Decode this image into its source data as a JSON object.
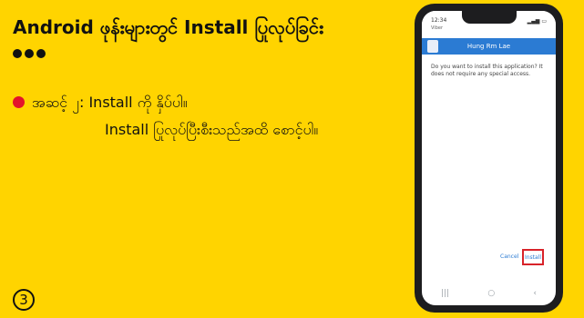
{
  "slide": {
    "title": "Android ဖုန်းများတွင် Install ပြုလုပ်ခြင်း",
    "step_line1": "အဆင့် ၂: Install ကို နှိပ်ပါ။",
    "step_line2": "Install ပြုလုပ်ပြီးစီးသည်အထိ စောင့်ပါ။",
    "step_number": "3",
    "accent_color": "#ffd400",
    "bullet_color": "#e3132b"
  },
  "phone": {
    "status_time": "12:34",
    "status_sub": "Viber",
    "app_name": "Hung Rm Lae",
    "dialog_message": "Do you want to install this application? It does not require any special access.",
    "cancel_label": "Cancel",
    "install_label": "Install",
    "highlight_color": "#d8232a",
    "header_color": "#2b7bd3"
  }
}
